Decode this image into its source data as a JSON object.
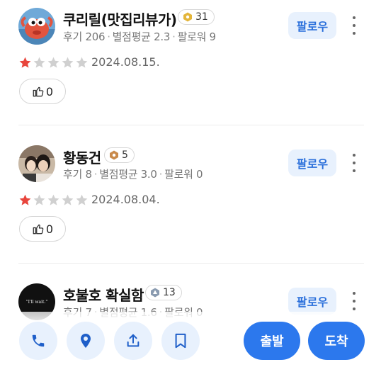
{
  "reviews": [
    {
      "name": "쿠리릴(맛집리뷰가)",
      "level": "31",
      "level_color": "#e3b53a",
      "stats": {
        "reviews": "후기 206",
        "avg": "별점평균 2.3",
        "followers": "팔로워 9"
      },
      "follow_label": "팔로우",
      "rating": 1,
      "date": "2024.08.15.",
      "likes": "0",
      "avatar_icon": "crab-character-avatar"
    },
    {
      "name": "황동건",
      "level": "5",
      "level_color": "#c98a4b",
      "stats": {
        "reviews": "후기 8",
        "avg": "별점평균 3.0",
        "followers": "팔로워 0"
      },
      "follow_label": "팔로우",
      "rating": 1,
      "date": "2024.08.04.",
      "likes": "0",
      "avatar_icon": "couple-photo-avatar"
    },
    {
      "name": "호불호 확실함",
      "level": "13",
      "level_color": "#8a9bb0",
      "stats": {
        "reviews": "후기 7",
        "avg": "별점평균 1.6",
        "followers": "팔로워 0"
      },
      "follow_label": "팔로우",
      "avatar_text": "\"I'll wait.\"",
      "avatar_icon": "black-text-avatar"
    }
  ],
  "bottom_bar": {
    "icons": [
      "phone-icon",
      "location-pin-icon",
      "share-icon",
      "bookmark-icon"
    ],
    "depart_label": "출발",
    "arrive_label": "도착"
  },
  "colors": {
    "accent": "#2c78ed",
    "star_filled": "#e8453c",
    "star_empty": "#d0d0d0"
  }
}
